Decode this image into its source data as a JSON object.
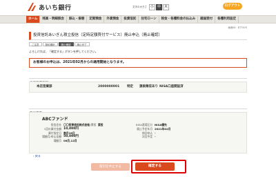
{
  "header": {
    "logo_text": "あいち銀行",
    "fontsize_label": "文字の大きさ",
    "fontsize_options": [
      "小",
      "中",
      "大"
    ],
    "logout_label": "ログアウト"
  },
  "nav": {
    "items": [
      "ホーム",
      "残高・明細照会",
      "振込・振替",
      "定期預金",
      "外貨預金",
      "投資信託",
      "住宅ローン",
      "税金・各種料金の払込み",
      "諸届受付",
      "各種利用設定"
    ]
  },
  "datetime": "画面ID：BTT405",
  "title": "投資信託あいぎん積立投信（定時定額買付サービス）廃止申込（廃止確認）",
  "steps": [
    "ご注意",
    "契約選択",
    "廃止確認",
    "廃止完了"
  ],
  "instruction": "よろしければ、「確定する」ボタンを押してください。",
  "notice": "お客様のお申込は、2021年02月からの適用開始となります。",
  "sections": {
    "account": "投信口座情報",
    "trade": "取引内容"
  },
  "account": {
    "branch": "本店営業部",
    "number": "2000000001",
    "kind": "特定",
    "deposit": "源泉徴収あり",
    "nisa": "NISA口座開設済"
  },
  "trade": {
    "fund_name": "ABCファンド",
    "left_rows": [
      {
        "k": "投信会社",
        "v": "〇〇投資信託株式会社"
      },
      {
        "k": "1回の買付金額",
        "v": "10,000円"
      },
      {
        "k": "買付指定日",
        "v": "毎月26日"
      },
      {
        "k": "増額月/申込金額",
        "v": "50,000円"
      },
      {
        "k": "増額月",
        "v": "06月,12月"
      }
    ],
    "mid_rows": [
      {
        "k": "一般/累投",
        "v": "累投"
      }
    ],
    "right_rows": [
      {
        "k": "NISA適用区分",
        "v": "NISA優先"
      },
      {
        "k": "廃止予定年月",
        "v": "2021年02月"
      },
      {
        "k": "前回申込",
        "v": "-"
      },
      {
        "k": "次回予定",
        "v": "-"
      }
    ]
  },
  "back_link": "戻る",
  "buttons": {
    "cancel": "取引を中止する",
    "confirm": "確定する"
  },
  "colors": {
    "accent": "#d94a1e",
    "logout": "#f6a623",
    "highlight_frame": "#e00000"
  }
}
